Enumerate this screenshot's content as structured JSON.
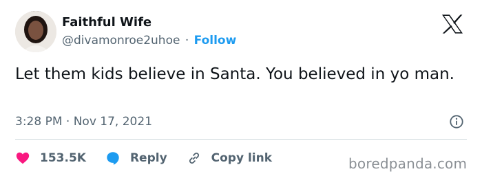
{
  "header": {
    "name": "Faithful Wife",
    "handle": "@divamonroe2uhoe",
    "separator": "·",
    "follow_label": "Follow"
  },
  "tweet": {
    "text": "Let them kids believe in Santa. You believed in yo man."
  },
  "meta": {
    "time": "3:28 PM",
    "separator": "·",
    "date": "Nov 17, 2021"
  },
  "actions": {
    "likes": "153.5K",
    "reply_label": "Reply",
    "copy_link_label": "Copy link"
  },
  "watermark": "boredpanda.com",
  "colors": {
    "text": "#0f1419",
    "secondary": "#536471",
    "accent": "#1d9bf0",
    "like": "#f91880",
    "divider": "#cfd9de"
  },
  "icons": {
    "logo": "x-logo-icon",
    "info": "info-icon",
    "like": "heart-icon",
    "reply": "speech-bubble-icon",
    "copy": "link-icon"
  }
}
